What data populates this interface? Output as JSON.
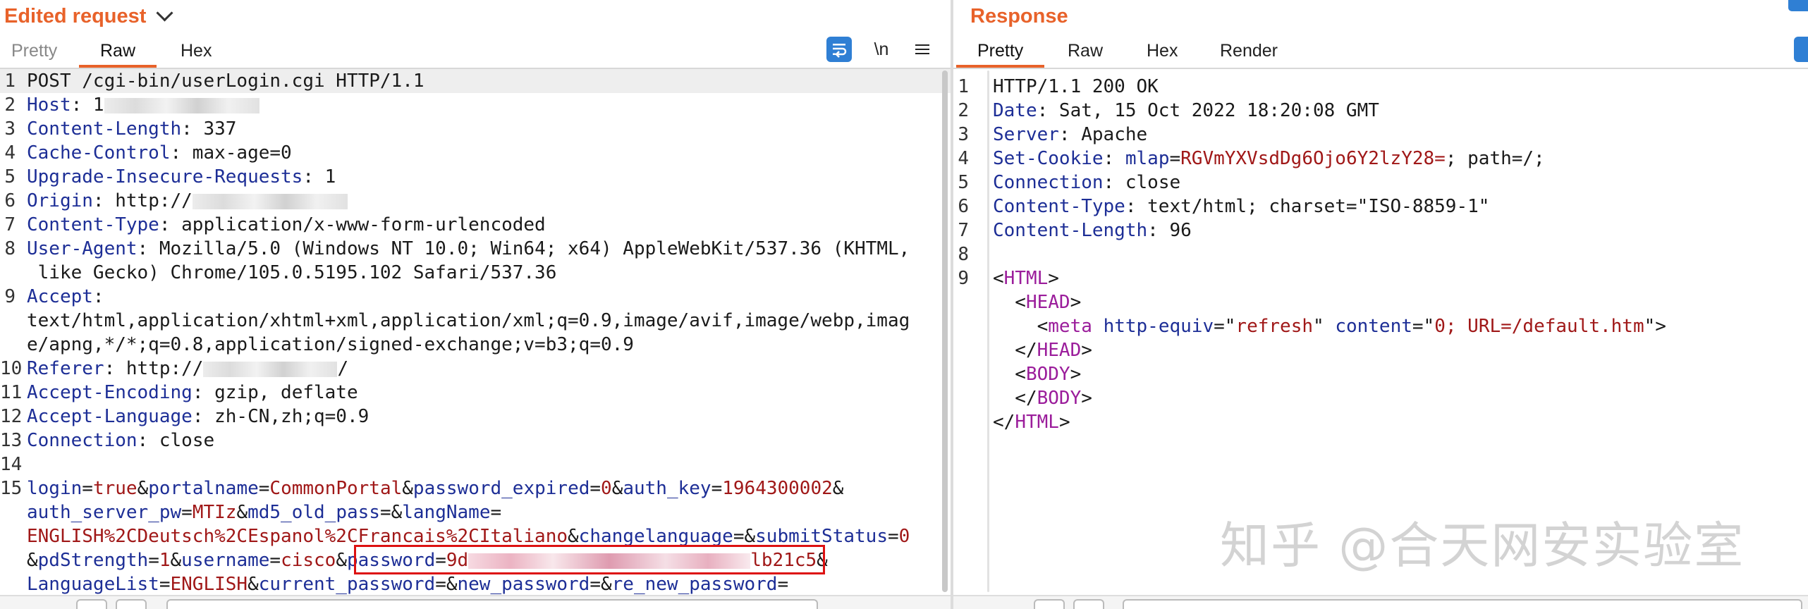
{
  "left": {
    "title": "Edited request",
    "tabs": [
      "Pretty",
      "Raw",
      "Hex"
    ],
    "active_tab": "Raw",
    "newline_toggle": "\\n",
    "lines": [
      {
        "n": "1",
        "parts": [
          [
            "v",
            "POST /cgi-bin/userLogin.cgi HTTP/1.1"
          ]
        ]
      },
      {
        "n": "2",
        "parts": [
          [
            "k",
            "Host"
          ],
          [
            "v",
            ": 1"
          ],
          [
            "blurw",
            "220"
          ]
        ]
      },
      {
        "n": "3",
        "parts": [
          [
            "k",
            "Content-Length"
          ],
          [
            "v",
            ": 337"
          ]
        ]
      },
      {
        "n": "4",
        "parts": [
          [
            "k",
            "Cache-Control"
          ],
          [
            "v",
            ": max-age=0"
          ]
        ]
      },
      {
        "n": "5",
        "parts": [
          [
            "k",
            "Upgrade-Insecure-Requests"
          ],
          [
            "v",
            ": 1"
          ]
        ]
      },
      {
        "n": "6",
        "parts": [
          [
            "k",
            "Origin"
          ],
          [
            "v",
            ": http://"
          ],
          [
            "blurw",
            "220"
          ]
        ]
      },
      {
        "n": "7",
        "parts": [
          [
            "k",
            "Content-Type"
          ],
          [
            "v",
            ": application/x-www-form-urlencoded"
          ]
        ]
      },
      {
        "n": "8",
        "parts": [
          [
            "k",
            "User-Agent"
          ],
          [
            "v",
            ": Mozilla/5.0 (Windows NT 10.0; Win64; x64) AppleWebKit/537.36 (KHTML,"
          ]
        ]
      },
      {
        "n": "",
        "parts": [
          [
            "v",
            " like Gecko) Chrome/105.0.5195.102 Safari/537.36"
          ]
        ]
      },
      {
        "n": "9",
        "parts": [
          [
            "k",
            "Accept"
          ],
          [
            "v",
            ":"
          ]
        ]
      },
      {
        "n": "",
        "parts": [
          [
            "v",
            "text/html,application/xhtml+xml,application/xml;q=0.9,image/avif,image/webp,imag"
          ]
        ]
      },
      {
        "n": "",
        "parts": [
          [
            "v",
            "e/apng,*/*;q=0.8,application/signed-exchange;v=b3;q=0.9"
          ]
        ]
      },
      {
        "n": "10",
        "parts": [
          [
            "k",
            "Referer"
          ],
          [
            "v",
            ": http://"
          ],
          [
            "blurw",
            "190"
          ],
          [
            "v",
            "/"
          ]
        ]
      },
      {
        "n": "11",
        "parts": [
          [
            "k",
            "Accept-Encoding"
          ],
          [
            "v",
            ": gzip, deflate"
          ]
        ]
      },
      {
        "n": "12",
        "parts": [
          [
            "k",
            "Accept-Language"
          ],
          [
            "v",
            ": zh-CN,zh;q=0.9"
          ]
        ]
      },
      {
        "n": "13",
        "parts": [
          [
            "k",
            "Connection"
          ],
          [
            "v",
            ": close"
          ]
        ]
      },
      {
        "n": "14",
        "parts": []
      },
      {
        "n": "15",
        "parts": [
          [
            "k",
            "login"
          ],
          [
            "amp",
            "="
          ],
          [
            "pv",
            "true"
          ],
          [
            "amp",
            "&"
          ],
          [
            "k",
            "portalname"
          ],
          [
            "amp",
            "="
          ],
          [
            "pv",
            "CommonPortal"
          ],
          [
            "amp",
            "&"
          ],
          [
            "k",
            "password_expired"
          ],
          [
            "amp",
            "="
          ],
          [
            "pv",
            "0"
          ],
          [
            "amp",
            "&"
          ],
          [
            "k",
            "auth_key"
          ],
          [
            "amp",
            "="
          ],
          [
            "pv",
            "1964300002"
          ],
          [
            "amp",
            "&"
          ]
        ]
      },
      {
        "n": "",
        "parts": [
          [
            "k",
            "auth_server_pw"
          ],
          [
            "amp",
            "="
          ],
          [
            "pv",
            "MTIz"
          ],
          [
            "amp",
            "&"
          ],
          [
            "k",
            "md5_old_pass"
          ],
          [
            "amp",
            "=&"
          ],
          [
            "k",
            "langName"
          ],
          [
            "amp",
            "="
          ]
        ]
      },
      {
        "n": "",
        "parts": [
          [
            "pv",
            "ENGLISH%2CDeutsch%2CEspanol%2CFrancais%2CItaliano"
          ],
          [
            "amp",
            "&"
          ],
          [
            "k",
            "changelanguage"
          ],
          [
            "amp",
            "=&"
          ],
          [
            "k",
            "submitStatus"
          ],
          [
            "amp",
            "="
          ],
          [
            "pv",
            "0"
          ]
        ]
      },
      {
        "n": "",
        "parts": [
          [
            "amp",
            "&"
          ],
          [
            "k",
            "pdStrength"
          ],
          [
            "amp",
            "="
          ],
          [
            "pv",
            "1"
          ],
          [
            "amp",
            "&"
          ],
          [
            "k",
            "username"
          ],
          [
            "amp",
            "="
          ],
          [
            "pv",
            "cisco"
          ],
          [
            "amp",
            "&"
          ],
          [
            "k",
            "password"
          ],
          [
            "amp",
            "="
          ],
          [
            "pv",
            "9d"
          ],
          [
            "blurpink",
            "400"
          ],
          [
            "pv",
            "lb21c5"
          ],
          [
            "amp",
            "&"
          ]
        ]
      },
      {
        "n": "",
        "parts": [
          [
            "k",
            "LanguageList"
          ],
          [
            "amp",
            "="
          ],
          [
            "pv",
            "ENGLISH"
          ],
          [
            "amp",
            "&"
          ],
          [
            "k",
            "current_password"
          ],
          [
            "amp",
            "=&"
          ],
          [
            "k",
            "new_password"
          ],
          [
            "amp",
            "=&"
          ],
          [
            "k",
            "re_new_password"
          ],
          [
            "amp",
            "="
          ]
        ]
      }
    ]
  },
  "right": {
    "title": "Response",
    "tabs": [
      "Pretty",
      "Raw",
      "Hex",
      "Render"
    ],
    "active_tab": "Pretty",
    "lines": [
      {
        "n": "1",
        "parts": [
          [
            "v",
            "HTTP/1.1 200 OK"
          ]
        ]
      },
      {
        "n": "2",
        "parts": [
          [
            "k",
            "Date"
          ],
          [
            "v",
            ": Sat, 15 Oct 2022 18:20:08 GMT"
          ]
        ]
      },
      {
        "n": "3",
        "parts": [
          [
            "k",
            "Server"
          ],
          [
            "v",
            ": Apache"
          ]
        ]
      },
      {
        "n": "4",
        "parts": [
          [
            "k",
            "Set-Cookie"
          ],
          [
            "v",
            ": "
          ],
          [
            "k",
            "mlap"
          ],
          [
            "v",
            "="
          ],
          [
            "pv",
            "RGVmYXVsdDg6Ojo6Y2lzY28="
          ],
          [
            "v",
            "; path=/;"
          ]
        ]
      },
      {
        "n": "5",
        "parts": [
          [
            "k",
            "Connection"
          ],
          [
            "v",
            ": close"
          ]
        ]
      },
      {
        "n": "6",
        "parts": [
          [
            "k",
            "Content-Type"
          ],
          [
            "v",
            ": text/html; charset=\"ISO-8859-1\""
          ]
        ]
      },
      {
        "n": "7",
        "parts": [
          [
            "k",
            "Content-Length"
          ],
          [
            "v",
            ": 96"
          ]
        ]
      },
      {
        "n": "8",
        "parts": []
      },
      {
        "n": "9",
        "parts": [
          [
            "v",
            "<"
          ],
          [
            "tag",
            "HTML"
          ],
          [
            "v",
            ">"
          ]
        ]
      },
      {
        "n": "",
        "parts": [
          [
            "v",
            "  <"
          ],
          [
            "tag",
            "HEAD"
          ],
          [
            "v",
            ">"
          ]
        ]
      },
      {
        "n": "",
        "parts": [
          [
            "v",
            "    <"
          ],
          [
            "tag",
            "meta"
          ],
          [
            "v",
            " "
          ],
          [
            "attr",
            "http-equiv"
          ],
          [
            "v",
            "=\""
          ],
          [
            "sv",
            "refresh"
          ],
          [
            "v",
            "\" "
          ],
          [
            "attr",
            "content"
          ],
          [
            "v",
            "=\""
          ],
          [
            "sv",
            "0; URL=/default.htm"
          ],
          [
            "v",
            "\">"
          ]
        ]
      },
      {
        "n": "",
        "parts": [
          [
            "v",
            "  </"
          ],
          [
            "tag",
            "HEAD"
          ],
          [
            "v",
            ">"
          ]
        ]
      },
      {
        "n": "",
        "parts": [
          [
            "v",
            "  <"
          ],
          [
            "tag",
            "BODY"
          ],
          [
            "v",
            ">"
          ]
        ]
      },
      {
        "n": "",
        "parts": [
          [
            "v",
            "  </"
          ],
          [
            "tag",
            "BODY"
          ],
          [
            "v",
            ">"
          ]
        ]
      },
      {
        "n": "",
        "parts": [
          [
            "v",
            "</"
          ],
          [
            "tag",
            "HTML"
          ],
          [
            "v",
            ">"
          ]
        ]
      }
    ]
  },
  "watermark": "知乎 @合天网安实验室",
  "colors": {
    "accent": "#e8622a",
    "key": "#1d2e96",
    "value": "#a01818",
    "tag": "#9b1d9b",
    "highlight": "#d11111"
  },
  "icons": [
    "chevron-down-icon",
    "wrap-lines-icon",
    "menu-icon"
  ]
}
